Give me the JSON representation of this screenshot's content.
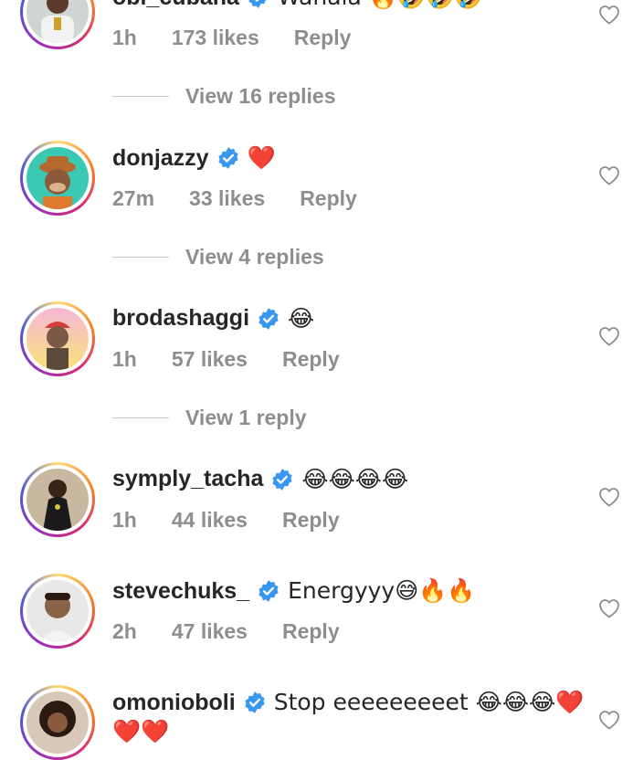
{
  "comments": [
    {
      "username": "obi_cubana",
      "text": "Wahala 🔥🤣🤣🤣",
      "time": "1h",
      "likes": "173 likes",
      "reply_label": "Reply",
      "view_replies": "View 16 replies"
    },
    {
      "username": "donjazzy",
      "text": "❤️",
      "time": "27m",
      "likes": "33 likes",
      "reply_label": "Reply",
      "view_replies": "View 4 replies"
    },
    {
      "username": "brodashaggi",
      "text": "😂",
      "time": "1h",
      "likes": "57 likes",
      "reply_label": "Reply",
      "view_replies": "View 1 reply"
    },
    {
      "username": "symply_tacha",
      "text": "😂😂😂😂",
      "time": "1h",
      "likes": "44 likes",
      "reply_label": "Reply"
    },
    {
      "username": "stevechuks_",
      "text": "Energyyy😅🔥🔥",
      "time": "2h",
      "likes": "47 likes",
      "reply_label": "Reply"
    },
    {
      "username": "omonioboli",
      "text": "Stop eeeeeeeeet 😂😂😂❤️",
      "text_line2": "❤️❤️"
    }
  ],
  "colors": {
    "verified_blue": "#3897f0",
    "meta_gray": "#8e8e8e",
    "heart_red": "#ed4956"
  },
  "icons": {
    "verified": "verified-badge-icon",
    "like": "heart-outline-icon"
  }
}
